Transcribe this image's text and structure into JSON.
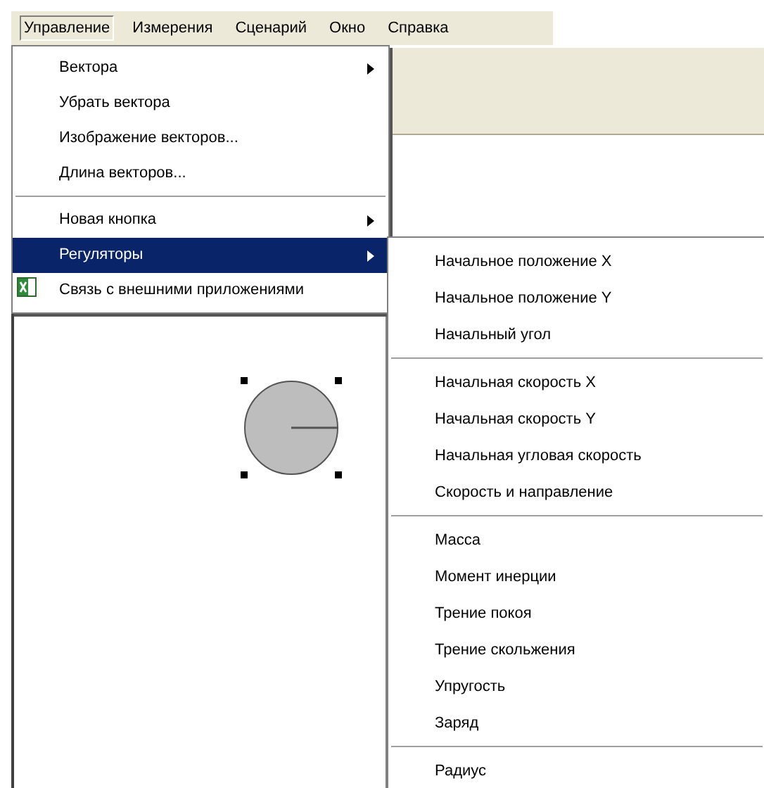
{
  "menubar": [
    {
      "label": "Управление",
      "selected": true
    },
    {
      "label": "Измерения",
      "selected": false
    },
    {
      "label": "Сценарий",
      "selected": false
    },
    {
      "label": "Окно",
      "selected": false
    },
    {
      "label": "Справка",
      "selected": false
    }
  ],
  "menu": {
    "items": [
      {
        "kind": "item",
        "label": "Вектора",
        "submenu": true,
        "selected": false
      },
      {
        "kind": "item",
        "label": "Убрать вектора",
        "submenu": false,
        "selected": false
      },
      {
        "kind": "item",
        "label": "Изображение векторов...",
        "submenu": false,
        "selected": false
      },
      {
        "kind": "item",
        "label": "Длина векторов...",
        "submenu": false,
        "selected": false
      },
      {
        "kind": "separator"
      },
      {
        "kind": "item",
        "label": "Новая кнопка",
        "submenu": true,
        "selected": false
      },
      {
        "kind": "item",
        "label": "Регуляторы",
        "submenu": true,
        "selected": true
      },
      {
        "kind": "item",
        "label": "Связь с внешними приложениями",
        "submenu": false,
        "selected": false,
        "icon": true
      }
    ]
  },
  "submenu": {
    "items": [
      {
        "kind": "item",
        "label": "Начальное положение X"
      },
      {
        "kind": "item",
        "label": "Начальное положение Y"
      },
      {
        "kind": "item",
        "label": "Начальный угол"
      },
      {
        "kind": "separator"
      },
      {
        "kind": "item",
        "label": "Начальная скорость X"
      },
      {
        "kind": "item",
        "label": "Начальная скорость Y"
      },
      {
        "kind": "item",
        "label": "Начальная угловая скорость"
      },
      {
        "kind": "item",
        "label": "Скорость и направление"
      },
      {
        "kind": "separator"
      },
      {
        "kind": "item",
        "label": "Масса"
      },
      {
        "kind": "item",
        "label": "Момент инерции"
      },
      {
        "kind": "item",
        "label": "Трение покоя"
      },
      {
        "kind": "item",
        "label": "Трение скольжения"
      },
      {
        "kind": "item",
        "label": "Упругость"
      },
      {
        "kind": "item",
        "label": "Заряд"
      },
      {
        "kind": "separator"
      },
      {
        "kind": "item",
        "label": "Радиус"
      }
    ]
  }
}
